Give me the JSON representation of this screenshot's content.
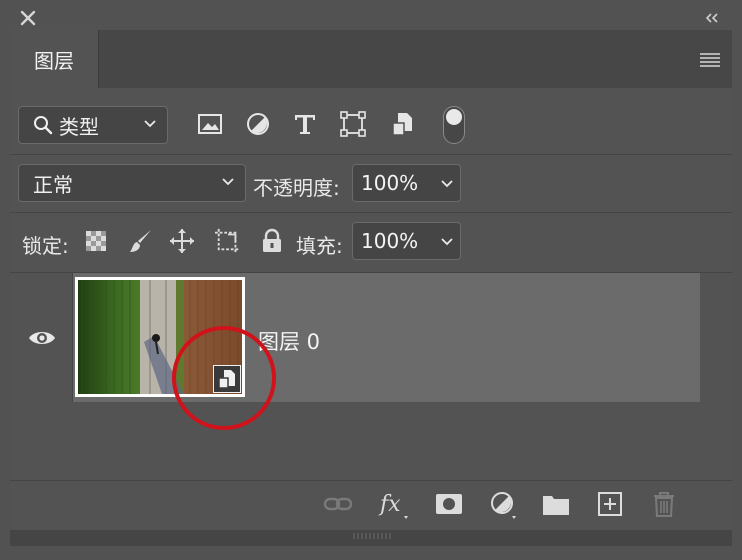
{
  "panel": {
    "tab_label": "图层"
  },
  "filter": {
    "kind_label": "类型",
    "icons": [
      "image-filter-icon",
      "adjustment-filter-icon",
      "type-filter-icon",
      "shape-filter-icon",
      "smart-object-filter-icon"
    ]
  },
  "blend": {
    "mode": "正常",
    "opacity_label": "不透明度:",
    "opacity_value": "100%"
  },
  "lock": {
    "label": "锁定:",
    "fill_label": "填充:",
    "fill_value": "100%",
    "icons": [
      "lock-transparent-pixels-icon",
      "lock-image-pixels-icon",
      "lock-position-icon",
      "lock-artboard-icon",
      "lock-all-icon"
    ]
  },
  "layers": [
    {
      "name": "图层 0",
      "visible": true,
      "smart_object": true
    }
  ],
  "footer": {
    "icons": [
      "link-layers-icon",
      "fx-icon",
      "mask-icon",
      "adjustment-layer-icon",
      "group-folder-icon",
      "new-layer-icon",
      "delete-icon"
    ]
  },
  "colors": {
    "panel_bg": "#535353",
    "selected_row": "#6b6b6b",
    "annotation": "#d0121b"
  }
}
